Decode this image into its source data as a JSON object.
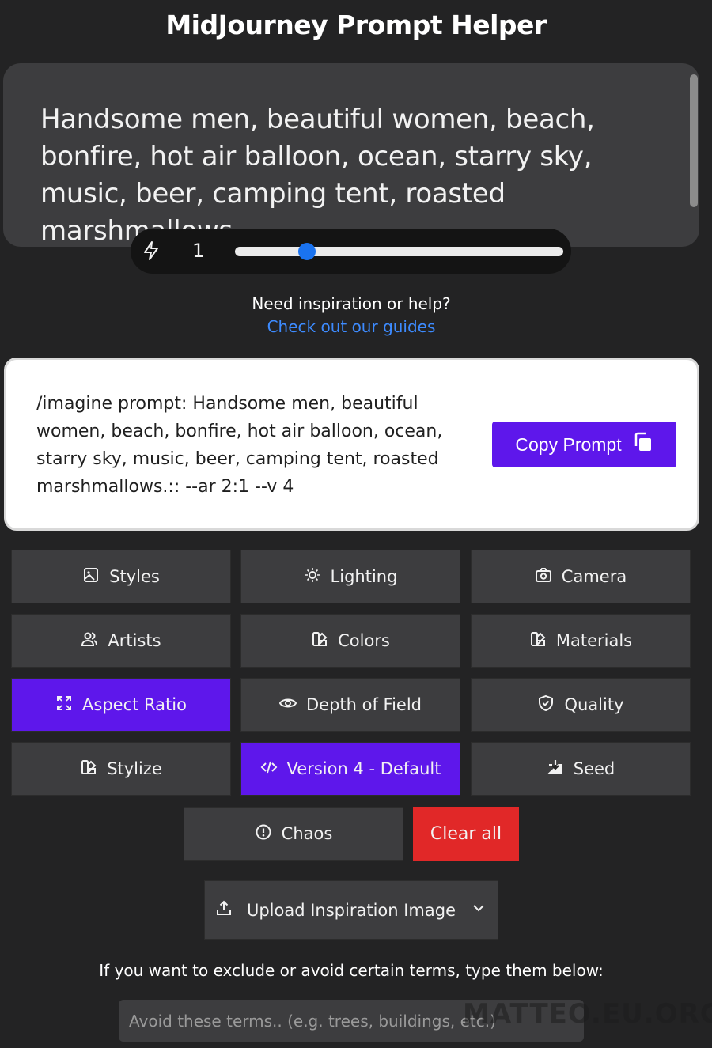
{
  "app": {
    "title": "MidJourney Prompt Helper"
  },
  "prompt_input": {
    "value": "Handsome men, beautiful women, beach, bonfire, hot air balloon, ocean, starry sky, music, beer, camping tent, roasted marshmallows"
  },
  "weight": {
    "value": "1",
    "slider_fraction": 0.22,
    "icon": "lightning-icon"
  },
  "help": {
    "text": "Need inspiration or help?",
    "link": "Check out our guides"
  },
  "output": {
    "text": "/imagine prompt: Handsome men, beautiful women, beach, bonfire, hot air balloon, ocean, starry sky, music, beer, camping tent, roasted marshmallows.:: --ar 2:1 --v 4",
    "copy_label": "Copy Prompt"
  },
  "options": {
    "styles": "Styles",
    "lighting": "Lighting",
    "camera": "Camera",
    "artists": "Artists",
    "colors": "Colors",
    "materials": "Materials",
    "aspect_ratio": "Aspect Ratio",
    "depth_of_field": "Depth of Field",
    "quality": "Quality",
    "stylize": "Stylize",
    "version": "Version 4 - Default",
    "seed": "Seed",
    "chaos": "Chaos",
    "clear_all": "Clear all"
  },
  "upload": {
    "label": "Upload Inspiration Image"
  },
  "exclude": {
    "label": "If you want to exclude or avoid certain terms, type them below:",
    "placeholder": "Avoid these terms.. (e.g. trees, buildings, etc.)"
  },
  "watermark": "MATTEO.EU.ORG",
  "colors": {
    "background": "#232324",
    "panel": "#3d3d3f",
    "accent": "#5e17eb",
    "danger": "#e12828",
    "link": "#3d8bff"
  }
}
